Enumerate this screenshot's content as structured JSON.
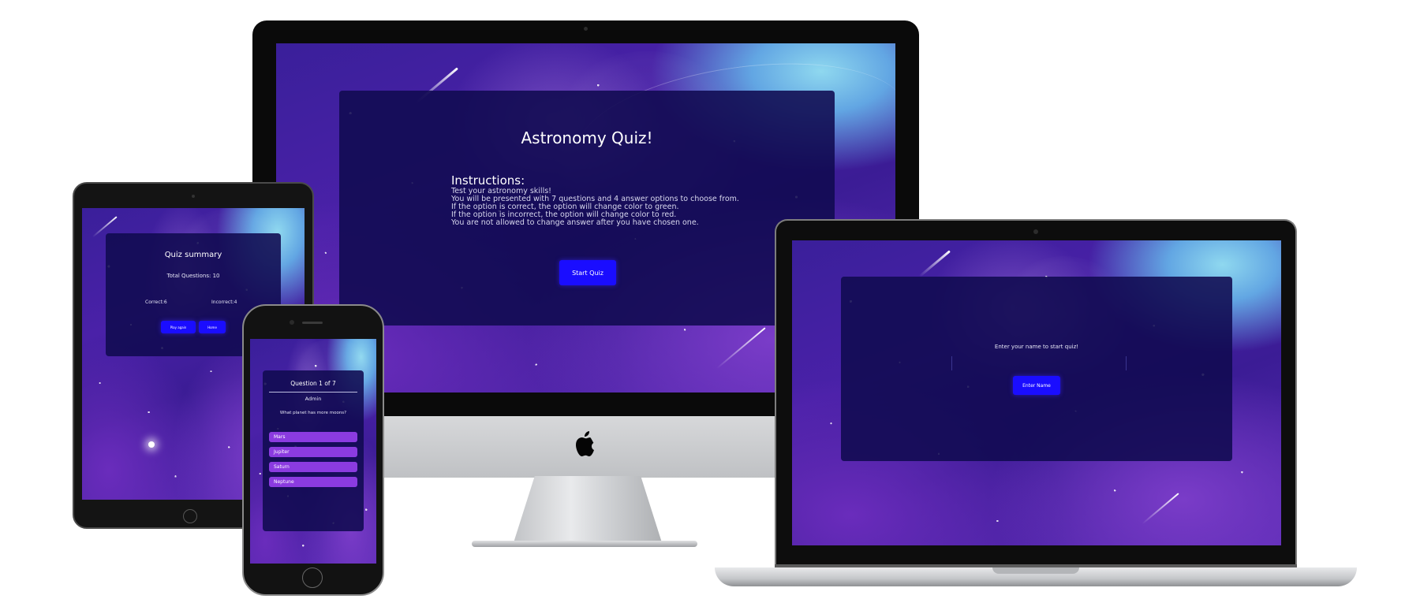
{
  "imac": {
    "title": "Astronomy Quiz!",
    "instructions_heading": "Instructions:",
    "instructions": [
      "Test your astronomy skills!",
      "You will be presented with 7 questions and 4 answer options to choose from.",
      "If the option is correct, the option will change color to green.",
      "If the option is incorrect, the option will change color to red.",
      "You are not allowed to change answer after you have chosen one."
    ],
    "start_button": "Start Quiz"
  },
  "tablet": {
    "title": "Quiz summary",
    "total_questions": "Total Questions: 10",
    "correct": "Correct:6",
    "incorrect": "Incorrect:4",
    "play_again_button": "Play again",
    "home_button": "Home"
  },
  "phone": {
    "question_counter": "Question 1 of 7",
    "player_name": "Admin",
    "question": "What planet has more moons?",
    "answers": [
      "Mars",
      "Jupiter",
      "Saturn",
      "Neptune"
    ]
  },
  "laptop": {
    "prompt": "Enter your name to start quiz!",
    "name_input_placeholder": "",
    "enter_button": "Enter Name"
  },
  "colors": {
    "accent_button": "#1a0dff",
    "answer_option": "#8b3be0",
    "card_background": "#100a50"
  }
}
